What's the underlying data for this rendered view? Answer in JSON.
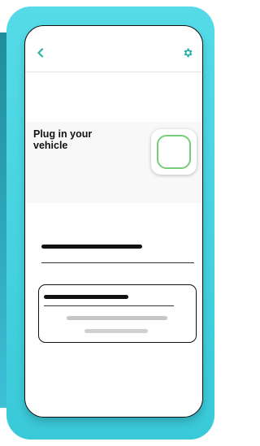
{
  "screen": {
    "card": {
      "title": "Plug in your vehicle"
    }
  },
  "icons": {
    "back": "chevron-left-icon",
    "settings": "gear-icon",
    "plug": "rounded-square-outline-icon"
  },
  "colors": {
    "accent_teal": "#2bb3a8",
    "frame_cyan": "#4fd6e4",
    "plug_green": "#78cd78"
  }
}
